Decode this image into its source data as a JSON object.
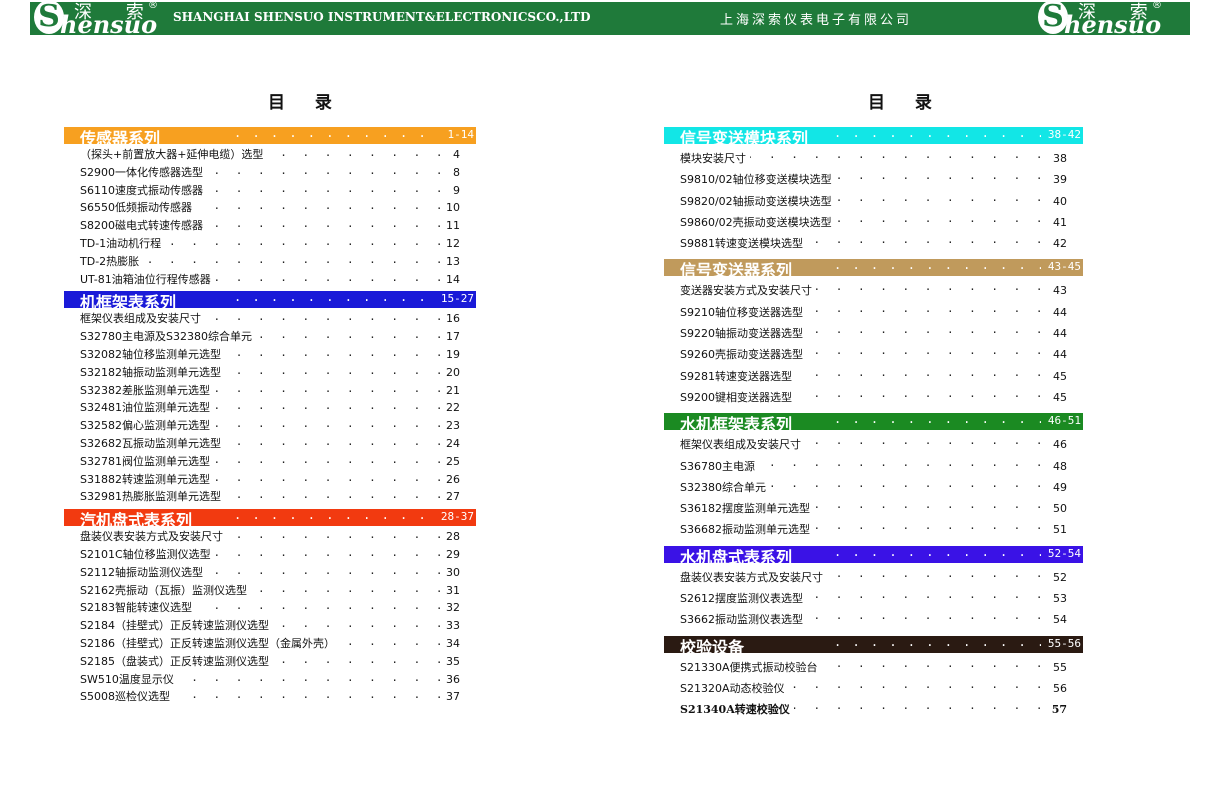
{
  "header": {
    "logo_cn": "深 索",
    "logo_reg": "®",
    "logo_en": "hensuo",
    "logo_initial": "S",
    "company_en": "SHANGHAI SHENSUO INSTRUMENT&ELECTRONICSCO.,LTD",
    "company_cn": "上海深索仪表电子有限公司"
  },
  "left": {
    "title": "目 录",
    "sections": [
      {
        "name": "传感器系列",
        "range": "1-14",
        "color": "#f7a020",
        "items": [
          {
            "label": "（探头+前置放大器+延伸电缆）选型",
            "page": "4"
          },
          {
            "label": "S2900一体化传感器选型",
            "page": "8"
          },
          {
            "label": "S6110速度式振动传感器",
            "page": "9"
          },
          {
            "label": "S6550低频振动传感器",
            "page": "10"
          },
          {
            "label": "S8200磁电式转速传感器",
            "page": "11"
          },
          {
            "label": "TD-1油动机行程",
            "page": "12"
          },
          {
            "label": "TD-2热膨胀",
            "page": "13"
          },
          {
            "label": "UT-81油箱油位行程传感器",
            "page": "14"
          }
        ]
      },
      {
        "name": "机框架表系列",
        "range": "15-27",
        "color": "#1a1ad8",
        "items": [
          {
            "label": "框架仪表组成及安装尺寸",
            "page": "16"
          },
          {
            "label": "S32780主电源及S32380综合单元",
            "page": "17"
          },
          {
            "label": "S32082轴位移监测单元选型",
            "page": "19"
          },
          {
            "label": "S32182轴振动监测单元选型",
            "page": "20"
          },
          {
            "label": "S32382差胀监测单元选型",
            "page": "21"
          },
          {
            "label": "S32481油位监测单元选型",
            "page": "22"
          },
          {
            "label": "S32582偏心监测单元选型",
            "page": "23"
          },
          {
            "label": "S32682瓦振动监测单元选型",
            "page": "24"
          },
          {
            "label": "S32781阀位监测单元选型",
            "page": "25"
          },
          {
            "label": "S31882转速监测单元选型",
            "page": "26"
          },
          {
            "label": "S32981热膨胀监测单元选型",
            "page": "27"
          }
        ]
      },
      {
        "name": "汽机盘式表系列",
        "range": "28-37",
        "color": "#f23a10",
        "items": [
          {
            "label": "盘装仪表安装方式及安装尺寸",
            "page": "28"
          },
          {
            "label": "S2101C轴位移监测仪选型",
            "page": "29"
          },
          {
            "label": "S2112轴振动监测仪选型",
            "page": "30"
          },
          {
            "label": "S2162壳振动（瓦振）监测仪选型",
            "page": "31"
          },
          {
            "label": "S2183智能转速仪选型",
            "page": "32"
          },
          {
            "label": "S2184（挂壁式）正反转速监测仪选型",
            "page": "33"
          },
          {
            "label": "S2186（挂壁式）正反转速监测仪选型（金属外壳）",
            "page": "34"
          },
          {
            "label": "S2185（盘装式）正反转速监测仪选型",
            "page": "35"
          },
          {
            "label": "SW510温度显示仪",
            "page": "36"
          },
          {
            "label": "S5008巡检仪选型",
            "page": "37"
          }
        ]
      }
    ]
  },
  "right": {
    "title": "目 录",
    "sections": [
      {
        "name": "信号变送模块系列",
        "range": "38-42",
        "color": "#12e6e6",
        "items": [
          {
            "label": "模块安装尺寸",
            "page": "38"
          },
          {
            "label": "S9810/02轴位移变送模块选型",
            "page": "39"
          },
          {
            "label": "S9820/02轴振动变送模块选型",
            "page": "40"
          },
          {
            "label": "S9860/02壳振动变送模块选型",
            "page": "41"
          },
          {
            "label": "S9881转速变送模块选型",
            "page": "42"
          }
        ]
      },
      {
        "name": "信号变送器系列",
        "range": "43-45",
        "color": "#c09a5c",
        "items": [
          {
            "label": "变送器安装方式及安装尺寸",
            "page": "43"
          },
          {
            "label": "S9210轴位移变送器选型",
            "page": "44"
          },
          {
            "label": "S9220轴振动变送器选型",
            "page": "44"
          },
          {
            "label": "S9260壳振动变送器选型",
            "page": "44"
          },
          {
            "label": "S9281转速变送器选型",
            "page": "45"
          },
          {
            "label": "S9200键相变送器选型",
            "page": "45"
          }
        ]
      },
      {
        "name": "水机框架表系列",
        "range": "46-51",
        "color": "#1b8a22",
        "items": [
          {
            "label": "框架仪表组成及安装尺寸",
            "page": "46"
          },
          {
            "label": "S36780主电源",
            "page": "48"
          },
          {
            "label": "S32380综合单元",
            "page": "49"
          },
          {
            "label": "S36182摆度监测单元选型",
            "page": "50"
          },
          {
            "label": "S36682振动监测单元选型",
            "page": "51"
          }
        ]
      },
      {
        "name": "水机盘式表系列",
        "range": "52-54",
        "color": "#3a12e6",
        "items": [
          {
            "label": "盘装仪表安装方式及安装尺寸",
            "page": "52"
          },
          {
            "label": "S2612摆度监测仪表选型",
            "page": "53"
          },
          {
            "label": "S3662振动监测仪表选型",
            "page": "54"
          }
        ]
      },
      {
        "name": "校验设备",
        "range": "55-56",
        "color": "#2a1a12",
        "items": [
          {
            "label": "S21330A便携式振动校验台",
            "page": "55"
          },
          {
            "label": "S21320A动态校验仪",
            "page": "56"
          },
          {
            "label": "S21340A转速校验仪",
            "page": "57",
            "bold": true
          }
        ]
      }
    ]
  }
}
